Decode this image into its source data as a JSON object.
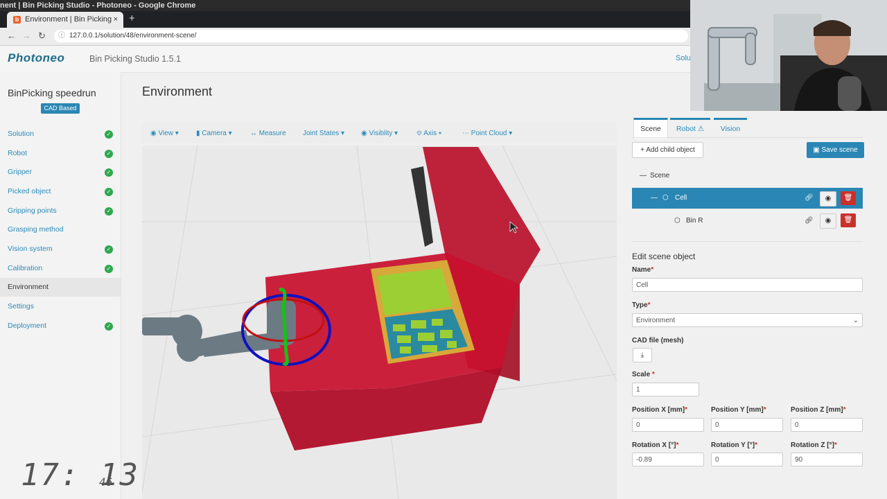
{
  "browser": {
    "window_title": "nent | Bin Picking Studio - Photoneo - Google Chrome",
    "tab_title": "Environment | Bin Picking",
    "tab_close": "×",
    "new_tab": "+",
    "url": "127.0.0.1/solution/48/environment-scene/"
  },
  "app": {
    "logo": "Photoneo",
    "title": "Bin Picking Studio 1.5.1",
    "header_link": "Soluti"
  },
  "sidebar": {
    "project": "BinPicking speedrun",
    "badge": "CAD Based",
    "items": [
      {
        "label": "Solution",
        "done": true
      },
      {
        "label": "Robot",
        "done": true
      },
      {
        "label": "Gripper",
        "done": true
      },
      {
        "label": "Picked object",
        "done": true
      },
      {
        "label": "Gripping points",
        "done": true
      },
      {
        "label": "Grasping method",
        "done": false
      },
      {
        "label": "Vision system",
        "done": true
      },
      {
        "label": "Calibration",
        "done": true
      },
      {
        "label": "Environment",
        "done": false,
        "active": true
      },
      {
        "label": "Settings",
        "done": false
      },
      {
        "label": "Deployment",
        "done": true
      }
    ],
    "check_glyph": "✓"
  },
  "main": {
    "title": "Environment",
    "toolbar": [
      "View",
      "Camera",
      "Measure",
      "Joint States",
      "Visiblity",
      "Axis",
      "Point Cloud"
    ]
  },
  "panel": {
    "tabs": [
      {
        "label": "Scene",
        "active": true
      },
      {
        "label": "Robot ⚠",
        "active": false
      },
      {
        "label": "Vision",
        "active": false
      }
    ],
    "add_child": "+ Add child object",
    "save_scene": "Save scene",
    "tree": {
      "root": "Scene",
      "cell": "Cell",
      "bin": "Bin R"
    },
    "edit_title": "Edit scene object",
    "fields": {
      "name_label": "Name",
      "name_value": "Cell",
      "type_label": "Type",
      "type_value": "Environment",
      "cad_label": "CAD file (mesh)",
      "scale_label": "Scale",
      "scale_value": "1",
      "pos_x_label": "Position X [mm]",
      "pos_y_label": "Position Y [mm]",
      "pos_z_label": "Position Z [mm]",
      "pos_x": "0",
      "pos_y": "0",
      "pos_z": "0",
      "rot_x_label": "Rotation X [°]",
      "rot_y_label": "Rotation Y [°]",
      "rot_z_label": "Rotation Z [°]",
      "rot_x": "-0.89",
      "rot_y": "0",
      "rot_z": "90",
      "required_mark": "*"
    }
  },
  "overlay": {
    "clock": "17: 13",
    "clock_seconds": "46"
  },
  "colors": {
    "accent": "#2a86b4",
    "success": "#2fa84f",
    "danger": "#c9302c",
    "cell_red": "#c8102e"
  }
}
